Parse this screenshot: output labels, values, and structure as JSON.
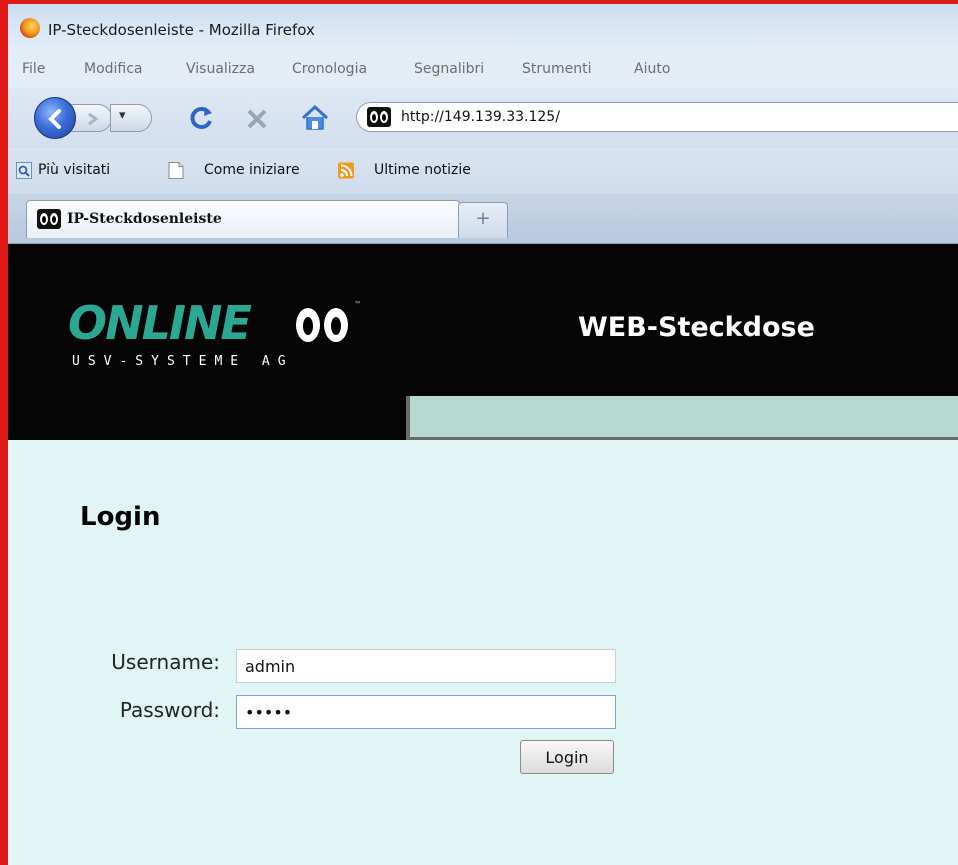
{
  "window": {
    "title": "IP-Steckdosenleiste - Mozilla Firefox"
  },
  "menu": {
    "items": [
      "File",
      "Modifica",
      "Visualizza",
      "Cronologia",
      "Segnalibri",
      "Strumenti",
      "Aiuto"
    ]
  },
  "nav": {
    "url": "http://149.139.33.125/"
  },
  "bookmarks": {
    "items": [
      "Più visitati",
      "Come iniziare",
      "Ultime notizie"
    ]
  },
  "tabs": {
    "active": "IP-Steckdosenleiste",
    "new_tab": "+"
  },
  "page": {
    "logo_word": "ONLINE",
    "logo_sub": "USV-SYSTEME AG",
    "logo_tm": "™",
    "header_title": "WEB-Steckdose",
    "login_heading": "Login",
    "username_label": "Username:",
    "username_value": "admin",
    "password_label": "Password:",
    "password_value": "admin",
    "login_button": "Login"
  },
  "colors": {
    "accent_red": "#e01818",
    "logo_teal": "#2aa892",
    "page_bg": "#e0f5f4",
    "header_bg": "#050505",
    "header_bar": "#b7d9d2"
  }
}
